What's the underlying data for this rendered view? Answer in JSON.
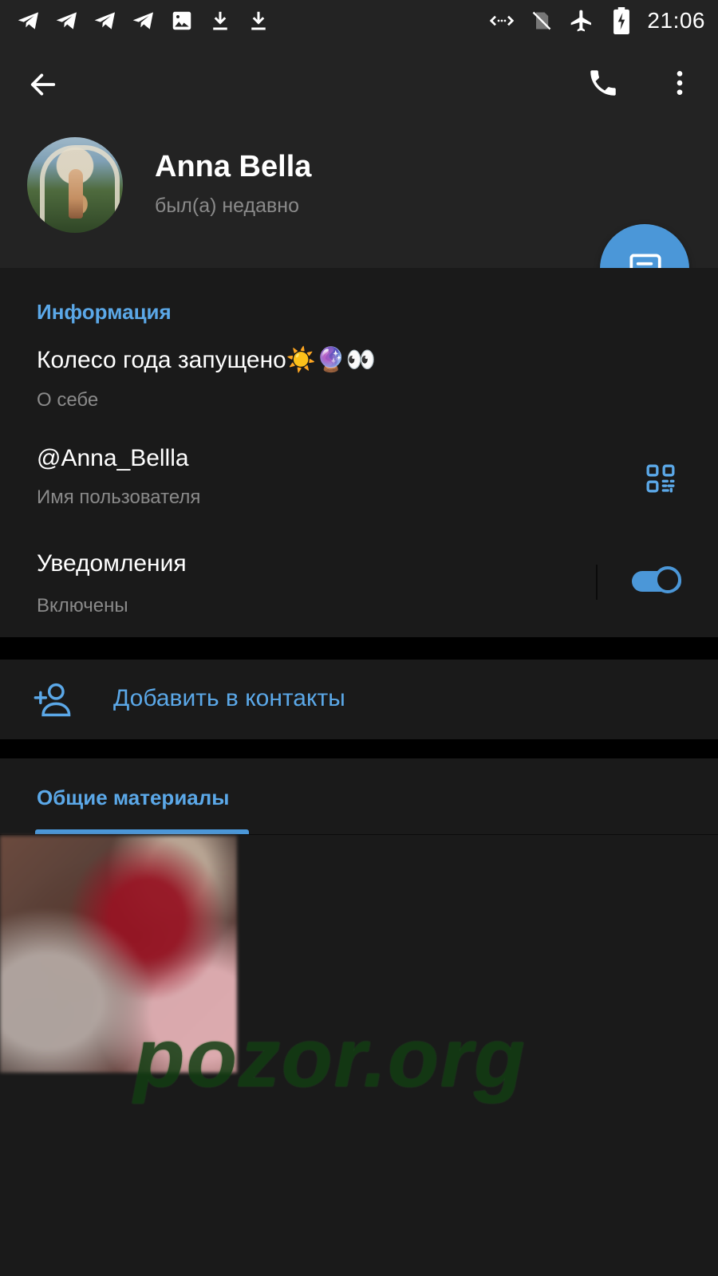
{
  "status_bar": {
    "time": "21:06",
    "left_icons": [
      "telegram-icon",
      "telegram-icon",
      "telegram-icon",
      "telegram-icon",
      "image-icon",
      "download-icon",
      "download-icon"
    ],
    "right_icons": [
      "data-saver-icon",
      "no-sim-icon",
      "airplane-icon",
      "battery-charging-icon"
    ]
  },
  "header": {
    "name": "Anna Bella",
    "status": "был(а) недавно",
    "buttons": [
      "back-arrow-icon",
      "phone-icon",
      "more-vert-icon"
    ]
  },
  "fab": {
    "icon": "message-icon",
    "color": "#4b97d8"
  },
  "info": {
    "title": "Информация",
    "bio": "Колесо года запущено☀️🔮👀",
    "bio_label": "О себе",
    "username": "@Anna_Bellla",
    "username_label": "Имя пользователя",
    "notifications": "Уведомления",
    "notifications_state": "Включены",
    "notifications_on": true
  },
  "add_contact": {
    "label": "Добавить в контакты",
    "icon": "add-user-icon"
  },
  "shared": {
    "tab_label": "Общие материалы"
  },
  "watermark": "pozor.org",
  "colors": {
    "accent": "#5ba8e8",
    "background": "#1a1a1a",
    "header": "#232323",
    "secondary_text": "#8a8a8a"
  }
}
